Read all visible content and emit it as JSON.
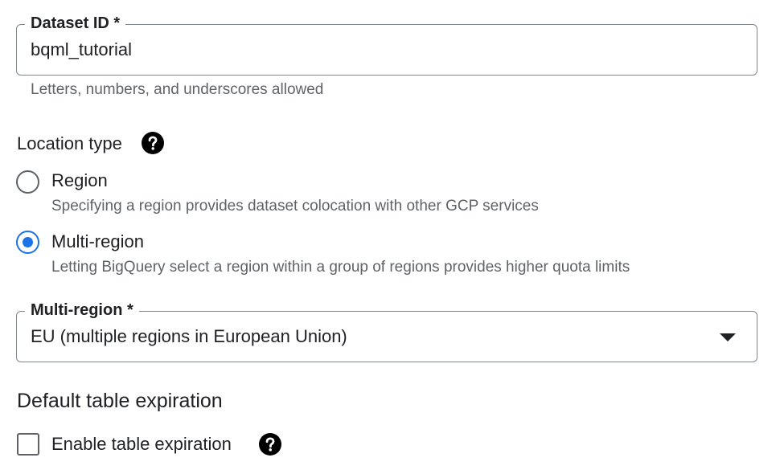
{
  "dataset_id": {
    "label": "Dataset ID *",
    "value": "bqml_tutorial",
    "hint": "Letters, numbers, and underscores allowed"
  },
  "location_type": {
    "heading": "Location type",
    "help_icon": "help-circle-icon",
    "options": [
      {
        "label": "Region",
        "description": "Specifying a region provides dataset colocation with other GCP services",
        "selected": false
      },
      {
        "label": "Multi-region",
        "description": "Letting BigQuery select a region within a group of regions provides higher quota limits",
        "selected": true
      }
    ]
  },
  "multi_region": {
    "label": "Multi-region *",
    "value": "EU (multiple regions in European Union)",
    "arrow_icon": "dropdown-arrow-icon"
  },
  "table_expiration": {
    "heading": "Default table expiration",
    "checkbox_label": "Enable table expiration",
    "checked": false,
    "help_icon": "help-circle-icon"
  },
  "colors": {
    "accent": "#1a73e8",
    "text": "#202124",
    "secondary_text": "#5f6368",
    "border": "#80868b"
  }
}
